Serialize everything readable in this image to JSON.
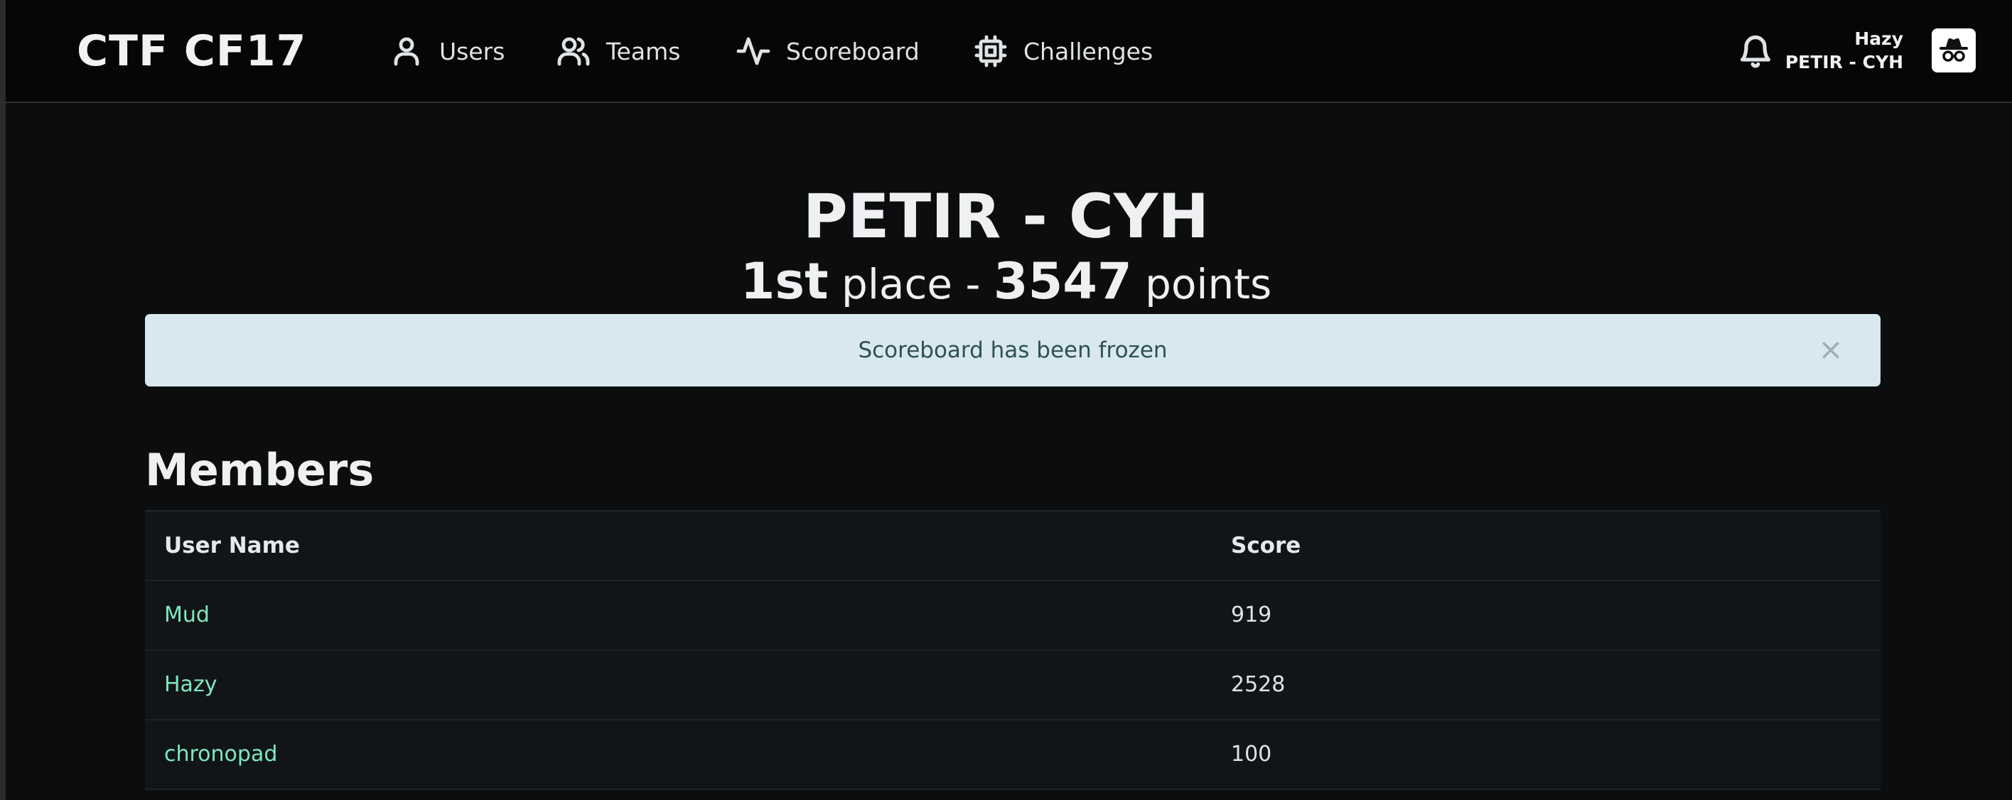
{
  "brand": "CTF CF17",
  "nav": {
    "users": "Users",
    "teams": "Teams",
    "scoreboard": "Scoreboard",
    "challenges": "Challenges"
  },
  "user": {
    "name": "Hazy",
    "team": "PETIR - CYH"
  },
  "team": {
    "name": "PETIR - CYH",
    "place": "1st",
    "place_word": "place",
    "separator": "-",
    "points": "3547",
    "points_word": "points"
  },
  "alert": {
    "message": "Scoreboard has been frozen",
    "close": "×"
  },
  "members": {
    "title": "Members",
    "columns": [
      "User Name",
      "Score"
    ],
    "rows": [
      {
        "name": "Mud",
        "score": "919"
      },
      {
        "name": "Hazy",
        "score": "2528"
      },
      {
        "name": "chronopad",
        "score": "100"
      }
    ]
  },
  "icons": {
    "users": "user-icon",
    "teams": "users-icon",
    "scoreboard": "activity-icon",
    "challenges": "cpu-icon",
    "notifications": "bell-icon",
    "avatar": "incognito-icon"
  },
  "colors": {
    "background": "#0b0d0e",
    "navbar": "#060606",
    "alert_bg": "#d8e8ee",
    "alert_text": "#2f4f57",
    "link": "#7ee8c0"
  }
}
